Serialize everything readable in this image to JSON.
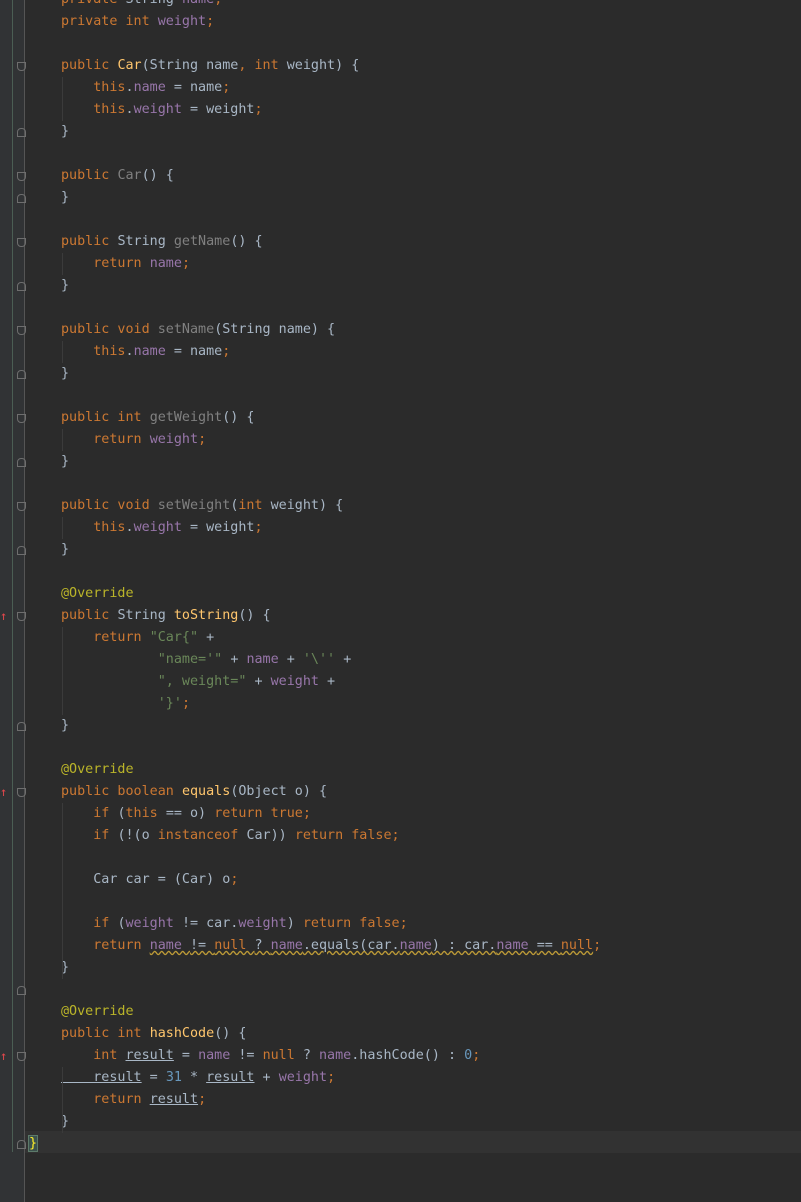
{
  "editor": {
    "lines": [
      [
        [
          "kw",
          "private "
        ],
        [
          "plain",
          "String "
        ],
        [
          "fld",
          "name"
        ],
        [
          "kw",
          ";"
        ]
      ],
      [
        [
          "kw",
          "private int "
        ],
        [
          "fld",
          "weight"
        ],
        [
          "kw",
          ";"
        ]
      ],
      [],
      [
        [
          "kw",
          "public "
        ],
        [
          "fn",
          "Car"
        ],
        [
          "plain",
          "(String name"
        ],
        [
          "kw",
          ", int "
        ],
        [
          "plain",
          "weight) {"
        ]
      ],
      [
        [
          "kw",
          "    this"
        ],
        [
          "plain",
          "."
        ],
        [
          "fld",
          "name "
        ],
        [
          "plain",
          "= name"
        ],
        [
          "kw",
          ";"
        ]
      ],
      [
        [
          "kw",
          "    this"
        ],
        [
          "plain",
          "."
        ],
        [
          "fld",
          "weight "
        ],
        [
          "plain",
          "= weight"
        ],
        [
          "kw",
          ";"
        ]
      ],
      [
        [
          "plain",
          "}"
        ]
      ],
      [],
      [
        [
          "kw",
          "public "
        ],
        [
          "dim",
          "Car"
        ],
        [
          "plain",
          "() {"
        ]
      ],
      [
        [
          "plain",
          "}"
        ]
      ],
      [],
      [
        [
          "kw",
          "public "
        ],
        [
          "plain",
          "String "
        ],
        [
          "dim",
          "getName"
        ],
        [
          "plain",
          "() {"
        ]
      ],
      [
        [
          "kw",
          "    return "
        ],
        [
          "fld",
          "name"
        ],
        [
          "kw",
          ";"
        ]
      ],
      [
        [
          "plain",
          "}"
        ]
      ],
      [],
      [
        [
          "kw",
          "public void "
        ],
        [
          "dim",
          "setName"
        ],
        [
          "plain",
          "(String name) {"
        ]
      ],
      [
        [
          "kw",
          "    this"
        ],
        [
          "plain",
          "."
        ],
        [
          "fld",
          "name "
        ],
        [
          "plain",
          "= name"
        ],
        [
          "kw",
          ";"
        ]
      ],
      [
        [
          "plain",
          "}"
        ]
      ],
      [],
      [
        [
          "kw",
          "public int "
        ],
        [
          "dim",
          "getWeight"
        ],
        [
          "plain",
          "() {"
        ]
      ],
      [
        [
          "kw",
          "    return "
        ],
        [
          "fld",
          "weight"
        ],
        [
          "kw",
          ";"
        ]
      ],
      [
        [
          "plain",
          "}"
        ]
      ],
      [],
      [
        [
          "kw",
          "public void "
        ],
        [
          "dim",
          "setWeight"
        ],
        [
          "plain",
          "("
        ],
        [
          "kw",
          "int "
        ],
        [
          "plain",
          "weight) {"
        ]
      ],
      [
        [
          "kw",
          "    this"
        ],
        [
          "plain",
          "."
        ],
        [
          "fld",
          "weight "
        ],
        [
          "plain",
          "= weight"
        ],
        [
          "kw",
          ";"
        ]
      ],
      [
        [
          "plain",
          "}"
        ]
      ],
      [],
      [
        [
          "ann",
          "@Override"
        ]
      ],
      [
        [
          "kw",
          "public "
        ],
        [
          "plain",
          "String "
        ],
        [
          "fn",
          "toString"
        ],
        [
          "plain",
          "() {"
        ]
      ],
      [
        [
          "kw",
          "    return "
        ],
        [
          "str",
          "\"Car{\" "
        ],
        [
          "plain",
          "+"
        ]
      ],
      [
        [
          "str",
          "            \"name='\" "
        ],
        [
          "plain",
          "+ "
        ],
        [
          "fld",
          "name "
        ],
        [
          "plain",
          "+ "
        ],
        [
          "str",
          "'\\'' "
        ],
        [
          "plain",
          "+"
        ]
      ],
      [
        [
          "str",
          "            \", weight=\" "
        ],
        [
          "plain",
          "+ "
        ],
        [
          "fld",
          "weight "
        ],
        [
          "plain",
          "+"
        ]
      ],
      [
        [
          "str",
          "            '}'"
        ],
        [
          "kw",
          ";"
        ]
      ],
      [
        [
          "plain",
          "}"
        ]
      ],
      [],
      [
        [
          "ann",
          "@Override"
        ]
      ],
      [
        [
          "kw",
          "public boolean "
        ],
        [
          "fn",
          "equals"
        ],
        [
          "plain",
          "(Object o) {"
        ]
      ],
      [
        [
          "kw",
          "    if "
        ],
        [
          "plain",
          "("
        ],
        [
          "kw",
          "this "
        ],
        [
          "plain",
          "== o) "
        ],
        [
          "kw",
          "return true;"
        ]
      ],
      [
        [
          "kw",
          "    if "
        ],
        [
          "plain",
          "(!(o "
        ],
        [
          "kw",
          "instanceof "
        ],
        [
          "plain",
          "Car)) "
        ],
        [
          "kw",
          "return false;"
        ]
      ],
      [],
      [
        [
          "plain",
          "    Car car = (Car) o"
        ],
        [
          "kw",
          ";"
        ]
      ],
      [],
      [
        [
          "kw",
          "    if "
        ],
        [
          "plain",
          "("
        ],
        [
          "fld",
          "weight "
        ],
        [
          "plain",
          "!= car."
        ],
        [
          "fld",
          "weight"
        ],
        [
          "plain",
          ") "
        ],
        [
          "kw",
          "return false;"
        ]
      ],
      [
        [
          "kw",
          "    return "
        ],
        [
          "fld|sq",
          "name "
        ],
        [
          "plain|sq",
          "!= "
        ],
        [
          "kw|sq",
          "null "
        ],
        [
          "plain|sq",
          "? "
        ],
        [
          "fld|sq",
          "name"
        ],
        [
          "plain|sq",
          ".equals(car."
        ],
        [
          "fld|sq",
          "name"
        ],
        [
          "plain|sq",
          ") : car."
        ],
        [
          "fld|sq",
          "name "
        ],
        [
          "plain|sq",
          "== "
        ],
        [
          "kw|sq",
          "null"
        ],
        [
          "kw",
          ";"
        ]
      ],
      [
        [
          "plain",
          "}"
        ]
      ],
      [],
      [
        [
          "ann",
          "@Override"
        ]
      ],
      [
        [
          "kw",
          "public int "
        ],
        [
          "fn",
          "hashCode"
        ],
        [
          "plain",
          "() {"
        ]
      ],
      [
        [
          "kw",
          "    int "
        ],
        [
          "plain|ul",
          "result"
        ],
        [
          "plain",
          " = "
        ],
        [
          "fld",
          "name "
        ],
        [
          "plain",
          "!= "
        ],
        [
          "kw",
          "null "
        ],
        [
          "plain",
          "? "
        ],
        [
          "fld",
          "name"
        ],
        [
          "plain",
          ".hashCode() : "
        ],
        [
          "num",
          "0"
        ],
        [
          "kw",
          ";"
        ]
      ],
      [
        [
          "plain|ul",
          "    result"
        ],
        [
          "plain",
          " = "
        ],
        [
          "num",
          "31 "
        ],
        [
          "plain",
          "* "
        ],
        [
          "plain|ul",
          "result"
        ],
        [
          "plain",
          " + "
        ],
        [
          "fld",
          "weight"
        ],
        [
          "kw",
          ";"
        ]
      ],
      [
        [
          "kw",
          "    return "
        ],
        [
          "plain|ul",
          "result"
        ],
        [
          "kw",
          ";"
        ]
      ],
      [
        [
          "plain",
          "}"
        ]
      ],
      [
        [
          "brace",
          "}"
        ]
      ]
    ]
  }
}
